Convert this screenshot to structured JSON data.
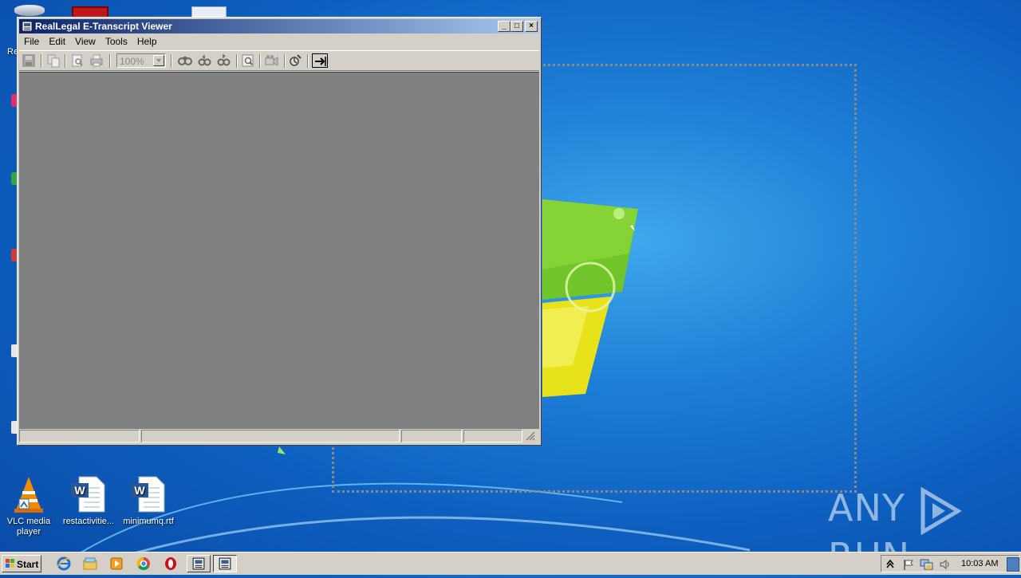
{
  "window": {
    "title": "RealLegal E-Transcript Viewer",
    "menu": [
      "File",
      "Edit",
      "View",
      "Tools",
      "Help"
    ],
    "toolbar": {
      "zoom_value": "100%",
      "buttons": [
        "save-icon",
        "copy-icon",
        "print-preview-icon",
        "print-icon",
        "find-icon",
        "find-next-icon",
        "find-previous-icon",
        "zoom-page-icon",
        "video-icon",
        "annotate-icon",
        "go-to-icon"
      ]
    },
    "controls": {
      "minimize": "_",
      "maximize": "□",
      "close": "×"
    }
  },
  "desktop": {
    "icons": [
      {
        "label": "VLC media player",
        "icon": "vlc-icon"
      },
      {
        "label": "restactivitie...",
        "icon": "word-document-icon"
      },
      {
        "label": "minimumq.rtf",
        "icon": "word-document-icon"
      }
    ],
    "partial_label": "Re"
  },
  "taskbar": {
    "start_label": "Start",
    "quick_launch": [
      "ie-icon",
      "explorer-icon",
      "media-player-icon",
      "chrome-icon",
      "opera-icon"
    ],
    "tasks": [
      "transcript-viewer-task",
      "transcript-viewer-task-active"
    ],
    "clock": "10:03 AM"
  },
  "watermark": {
    "left": "ANY",
    "right": "RUN"
  },
  "colors": {
    "titlebar_start": "#0a246a",
    "titlebar_end": "#a6caf0",
    "client": "#808080",
    "chrome": "#d4d0c8"
  }
}
